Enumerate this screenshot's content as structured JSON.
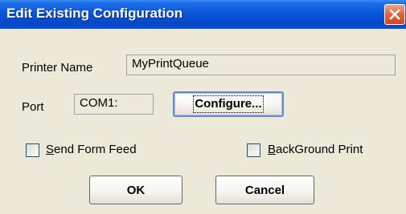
{
  "window": {
    "title": "Edit Existing Configuration"
  },
  "printer_name": {
    "label": "Printer Name",
    "value": "MyPrintQueue"
  },
  "port": {
    "label": "Port",
    "value": "COM1:",
    "configure_label": "Configure..."
  },
  "options": {
    "send_form_feed": {
      "label_mnemonic": "S",
      "label_rest": "end Form Feed",
      "checked": false
    },
    "background_print": {
      "label_mnemonic": "B",
      "label_rest": "ackGround Print",
      "checked": false
    }
  },
  "buttons": {
    "ok_label": "OK",
    "cancel_label": "Cancel"
  }
}
